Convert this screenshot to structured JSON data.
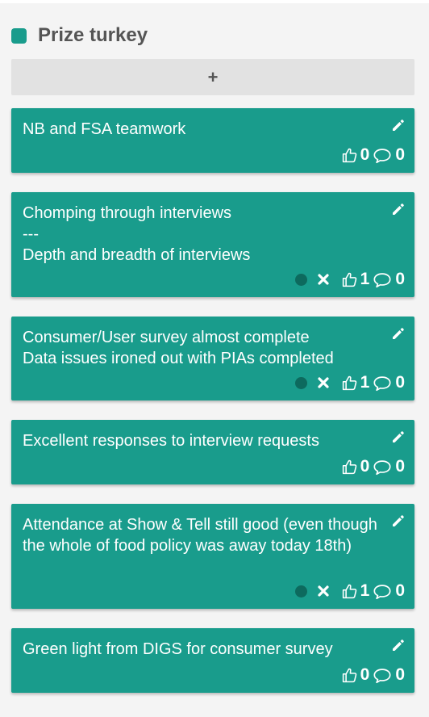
{
  "column": {
    "title": "Prize turkey",
    "color": "#199c8c",
    "add_label": "+"
  },
  "cards": [
    {
      "text": "NB and FSA teamwork",
      "votes": "0",
      "comments": "0",
      "has_delete": false
    },
    {
      "text": "Chomping through interviews\n---\nDepth and breadth of interviews",
      "votes": "1",
      "comments": "0",
      "has_delete": true
    },
    {
      "text": "Consumer/User survey almost complete\nData issues ironed out with PIAs completed",
      "votes": "1",
      "comments": "0",
      "has_delete": true
    },
    {
      "text": "Excellent responses to interview requests",
      "votes": "0",
      "comments": "0",
      "has_delete": false
    },
    {
      "text": "Attendance at Show & Tell still good (even though the whole of food policy was away today 18th)",
      "votes": "1",
      "comments": "0",
      "has_delete": true
    },
    {
      "text": "Green light from DIGS for consumer survey",
      "votes": "0",
      "comments": "0",
      "has_delete": false
    }
  ],
  "icons": {
    "edit": "pencil-icon",
    "delete": "x-icon",
    "vote": "thumbs-up-icon",
    "comment": "speech-bubble-icon",
    "status": "status-dot"
  }
}
